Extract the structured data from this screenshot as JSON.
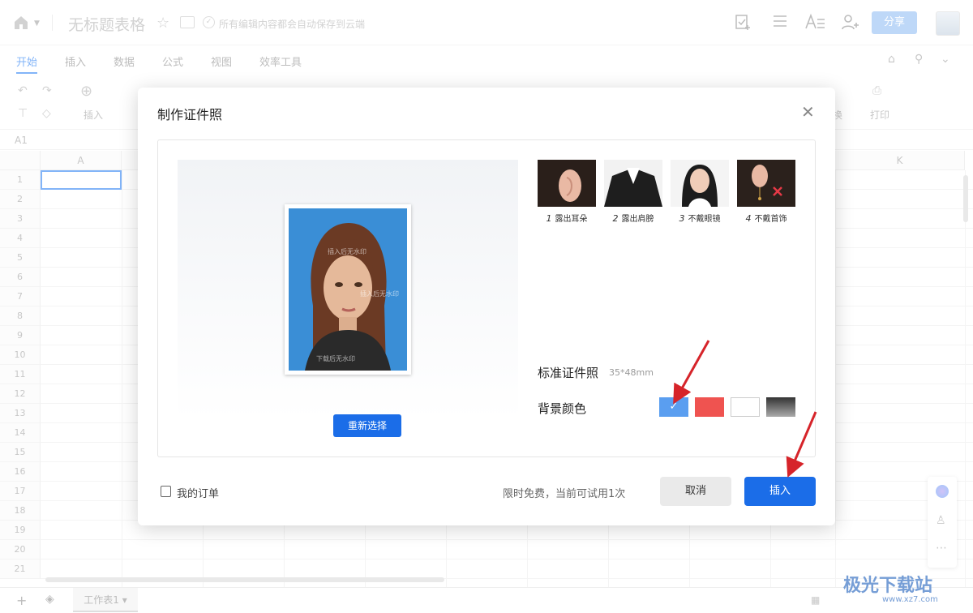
{
  "topbar": {
    "title": "无标题表格",
    "save_status": "所有编辑内容都会自动保存到云端",
    "share_label": "分享"
  },
  "menu": {
    "tabs": [
      "开始",
      "插入",
      "数据",
      "公式",
      "视图",
      "效率工具"
    ],
    "active": "开始"
  },
  "toolbar": {
    "insert_label": "插入",
    "replace_label": "换",
    "print_label": "打印"
  },
  "formula": {
    "cell_ref": "A1"
  },
  "sheet": {
    "columns": [
      "A",
      "K"
    ],
    "rows": [
      "1",
      "2",
      "3",
      "4",
      "5",
      "6",
      "7",
      "8",
      "9",
      "10",
      "11",
      "12",
      "13",
      "14",
      "15",
      "16",
      "17",
      "18",
      "19",
      "20",
      "21"
    ],
    "tab_name": "工作表1"
  },
  "dialog": {
    "title": "制作证件照",
    "reselect_label": "重新选择",
    "tips": [
      {
        "num": "1",
        "label": "露出耳朵"
      },
      {
        "num": "2",
        "label": "露出肩膀"
      },
      {
        "num": "3",
        "label": "不戴眼镜"
      },
      {
        "num": "4",
        "label": "不戴首饰"
      }
    ],
    "standard_label": "标准证件照",
    "standard_size": "35*48mm",
    "bg_color_label": "背景颜色",
    "bg_colors": [
      "#5a9ef0",
      "#ef5350",
      "#ffffff",
      "#555555"
    ],
    "selected_bg_index": 0,
    "orders_label": "我的订单",
    "free_text": "限时免费，当前可试用1次",
    "cancel_label": "取消",
    "insert_label": "插入",
    "photo_watermarks": [
      "插入后无水印",
      "下载后无水印"
    ]
  },
  "watermark": {
    "brand": "极光下载站",
    "url": "www.xz7.com"
  }
}
